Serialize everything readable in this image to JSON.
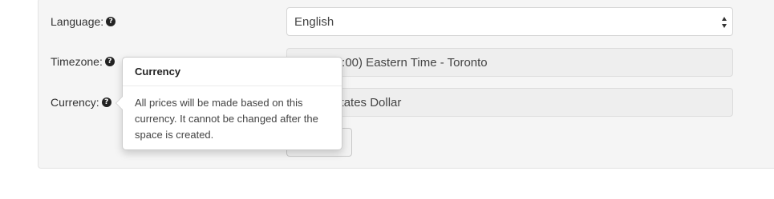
{
  "form": {
    "language": {
      "label": "Language:",
      "help_icon": "question-circle-icon",
      "value": "English"
    },
    "timezone": {
      "label": "Timezone:",
      "help_icon": "question-circle-icon",
      "value_visible": "(GMT-05:00) Eastern Time - Toronto"
    },
    "currency": {
      "label": "Currency:",
      "help_icon": "question-circle-icon",
      "value_visible": "United States Dollar"
    },
    "submit_button": {
      "label": ""
    }
  },
  "popover": {
    "title": "Currency",
    "content": "All prices will be made based on this currency. It cannot be changed after the space is created."
  },
  "colors": {
    "panel_bg": "#f5f5f5",
    "readonly_field_bg": "#eeeeee",
    "help_icon": "#222222"
  }
}
